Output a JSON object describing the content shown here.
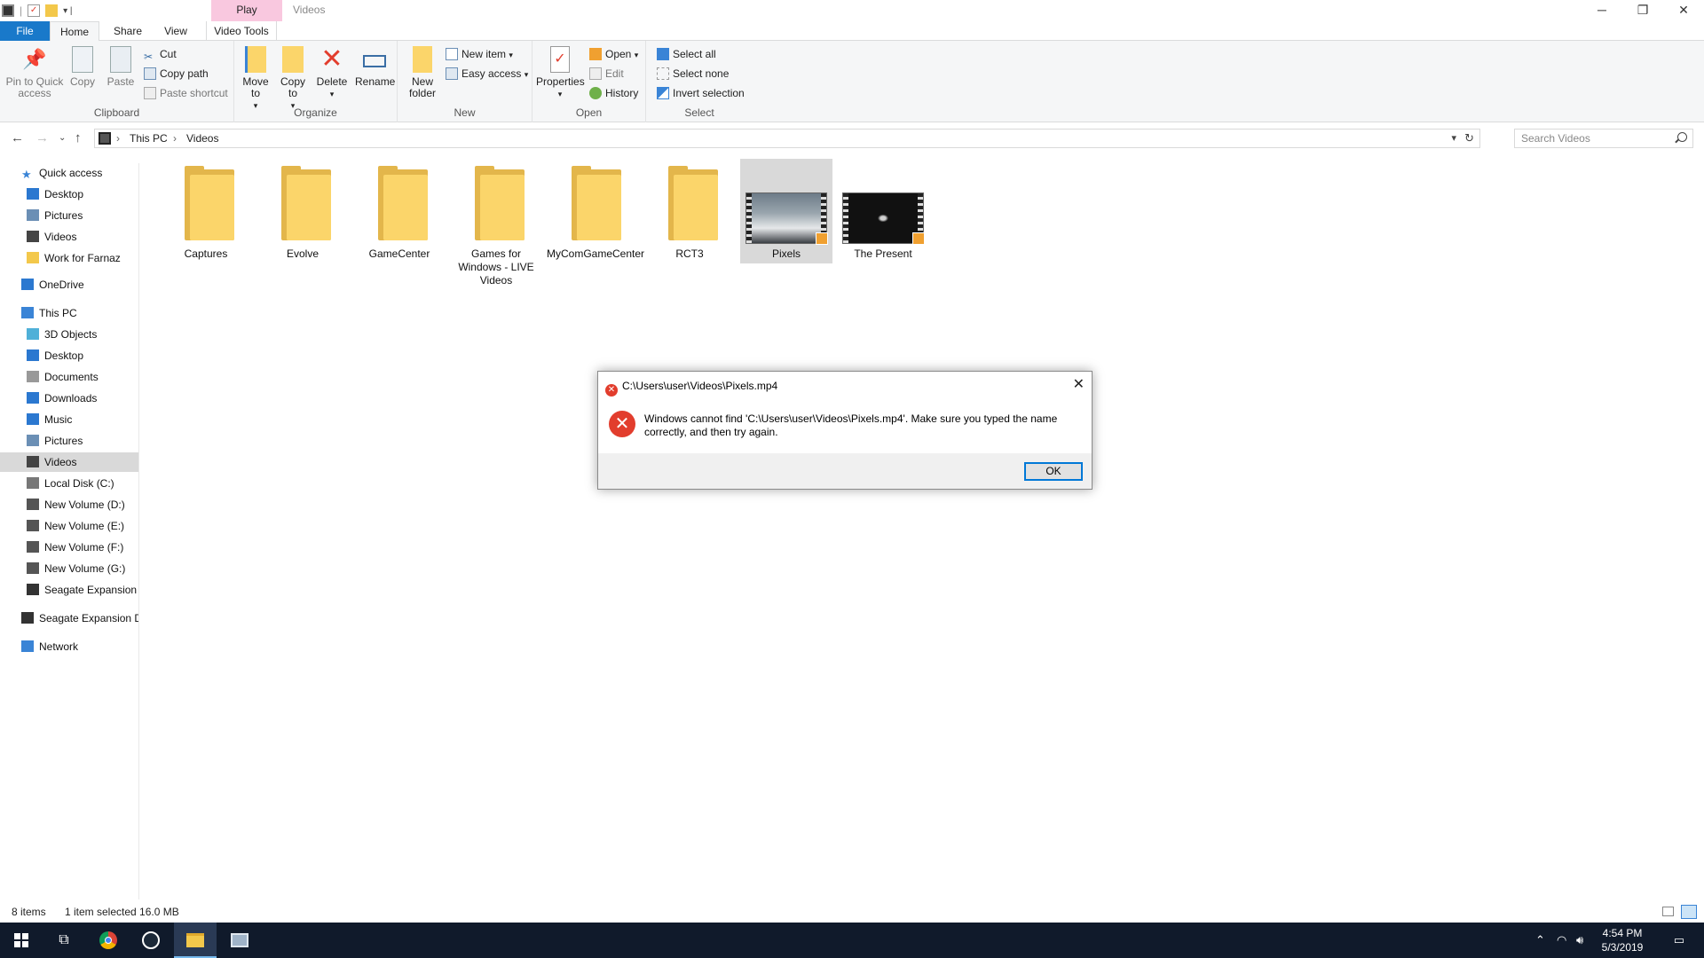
{
  "window": {
    "title": "Videos",
    "context_tab": "Play",
    "tabs": [
      "File",
      "Home",
      "Share",
      "View",
      "Video Tools"
    ]
  },
  "ribbon": {
    "clipboard": {
      "label": "Clipboard",
      "pin": "Pin to Quick access",
      "copy": "Copy",
      "paste": "Paste",
      "cut": "Cut",
      "copy_path": "Copy path",
      "paste_shortcut": "Paste shortcut"
    },
    "organize": {
      "label": "Organize",
      "move_to": "Move to",
      "copy_to": "Copy to",
      "delete": "Delete",
      "rename": "Rename"
    },
    "new": {
      "label": "New",
      "new_folder": "New folder",
      "new_item": "New item",
      "easy_access": "Easy access"
    },
    "open": {
      "label": "Open",
      "properties": "Properties",
      "open": "Open",
      "edit": "Edit",
      "history": "History"
    },
    "select": {
      "label": "Select",
      "select_all": "Select all",
      "select_none": "Select none",
      "invert": "Invert selection"
    }
  },
  "address": {
    "crumbs": [
      "This PC",
      "Videos"
    ],
    "search_placeholder": "Search Videos"
  },
  "nav": {
    "items": [
      {
        "label": "Quick access",
        "icon": "star-icon",
        "indent": 0
      },
      {
        "label": "Desktop",
        "icon": "desktop-icon",
        "indent": 1
      },
      {
        "label": "Pictures",
        "icon": "pictures-icon",
        "indent": 1
      },
      {
        "label": "Videos",
        "icon": "videos-icon",
        "indent": 1
      },
      {
        "label": "Work for Farnaz",
        "icon": "folder-icon",
        "indent": 1
      },
      {
        "label": "OneDrive",
        "icon": "cloud-icon",
        "indent": 0
      },
      {
        "label": "This PC",
        "icon": "pc-icon",
        "indent": 0
      },
      {
        "label": "3D Objects",
        "icon": "cube-icon",
        "indent": 1
      },
      {
        "label": "Desktop",
        "icon": "desktop-icon",
        "indent": 1
      },
      {
        "label": "Documents",
        "icon": "documents-icon",
        "indent": 1
      },
      {
        "label": "Downloads",
        "icon": "downloads-icon",
        "indent": 1
      },
      {
        "label": "Music",
        "icon": "music-icon",
        "indent": 1
      },
      {
        "label": "Pictures",
        "icon": "pictures-icon",
        "indent": 1
      },
      {
        "label": "Videos",
        "icon": "videos-icon",
        "indent": 1,
        "selected": true
      },
      {
        "label": "Local Disk (C:)",
        "icon": "disk-icon",
        "indent": 1
      },
      {
        "label": "New Volume (D:)",
        "icon": "drive-icon",
        "indent": 1
      },
      {
        "label": "New Volume (E:)",
        "icon": "drive-icon",
        "indent": 1
      },
      {
        "label": "New Volume (F:)",
        "icon": "drive-icon",
        "indent": 1
      },
      {
        "label": "New Volume (G:)",
        "icon": "drive-icon",
        "indent": 1
      },
      {
        "label": "Seagate Expansion D",
        "icon": "external-drive-icon",
        "indent": 1
      },
      {
        "label": "Seagate Expansion Dr",
        "icon": "external-drive-icon",
        "indent": 0
      },
      {
        "label": "Network",
        "icon": "network-icon",
        "indent": 0
      }
    ]
  },
  "files": [
    {
      "name": "Captures",
      "type": "folder"
    },
    {
      "name": "Evolve",
      "type": "folder"
    },
    {
      "name": "GameCenter",
      "type": "folder"
    },
    {
      "name": "Games for Windows - LIVE Videos",
      "type": "folder"
    },
    {
      "name": "MyComGameCenter",
      "type": "folder"
    },
    {
      "name": "RCT3",
      "type": "folder"
    },
    {
      "name": "Pixels",
      "type": "video",
      "selected": true
    },
    {
      "name": "The Present",
      "type": "video"
    }
  ],
  "status": {
    "count": "8 items",
    "selection": "1 item selected  16.0 MB"
  },
  "dialog": {
    "title": "C:\\Users\\user\\Videos\\Pixels.mp4",
    "message": "Windows cannot find 'C:\\Users\\user\\Videos\\Pixels.mp4'. Make sure you typed the name correctly, and then try again.",
    "ok": "OK"
  },
  "taskbar": {
    "time": "4:54 PM",
    "date": "5/3/2019",
    "apps": [
      "start-icon",
      "task-view-icon",
      "chrome-icon",
      "steam-icon",
      "file-explorer-icon",
      "app-icon"
    ]
  },
  "colors": {
    "accent": "#1979ca",
    "selection": "#d9d9d9",
    "error_red": "#e23d2d",
    "folder": "#fbd56a",
    "taskbar": "#101a2b"
  }
}
